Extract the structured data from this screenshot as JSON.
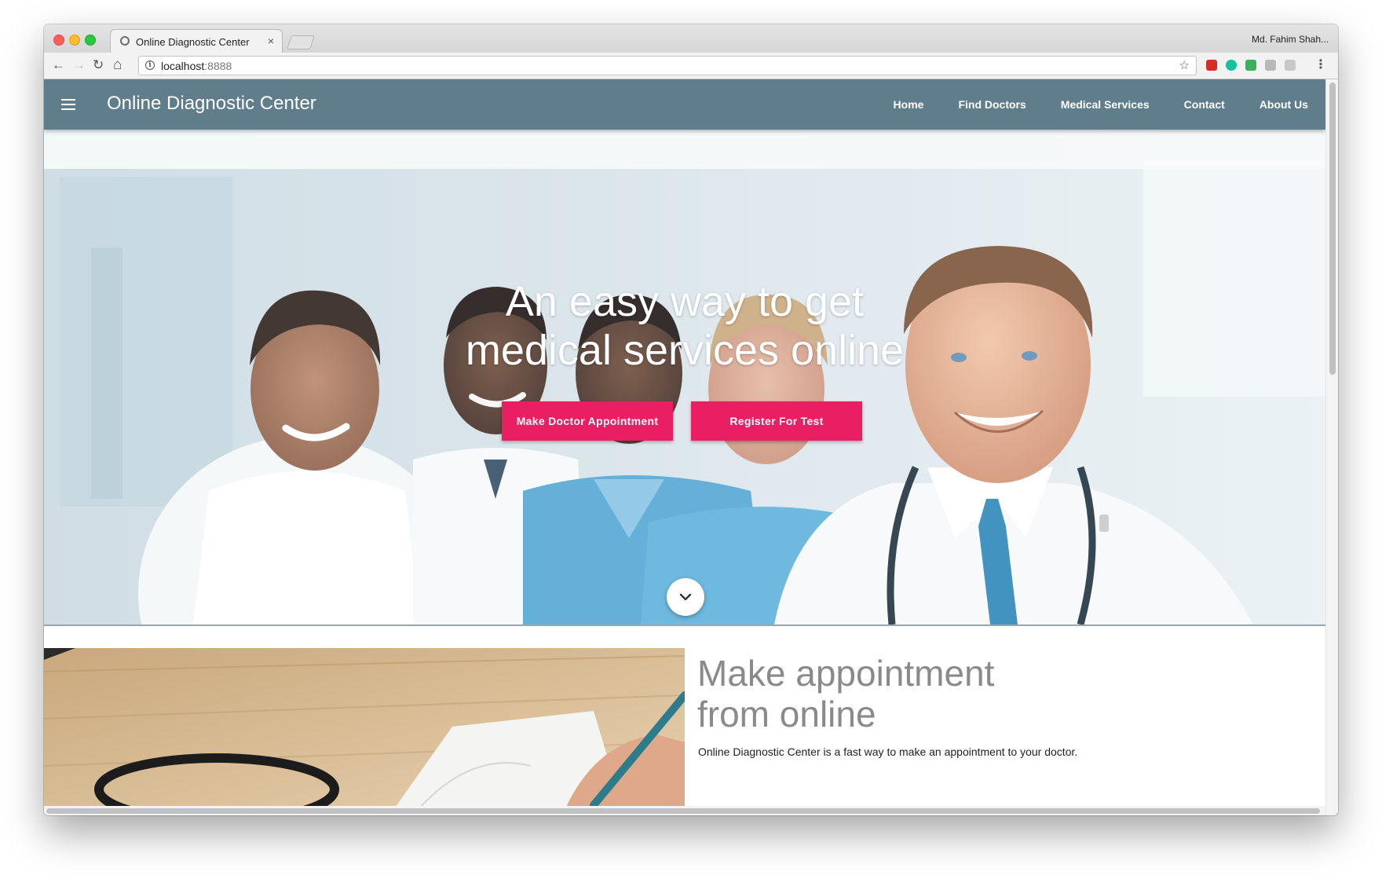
{
  "browser": {
    "tab_title": "Online Diagnostic Center",
    "tab_close": "×",
    "profile_name": "Md. Fahim Shah...",
    "url_host": "localhost",
    "url_port": ":8888",
    "info_glyph": "i",
    "star_glyph": "☆",
    "back_glyph": "←",
    "forward_glyph": "→",
    "reload_glyph": "↻",
    "home_glyph": "⌂",
    "menu_glyph": "⋮",
    "extensions": [
      {
        "name": "lastpass-extension-icon",
        "color": "#d32d27"
      },
      {
        "name": "grammarly-extension-icon",
        "color": "#15c39a"
      },
      {
        "name": "shield-extension-icon",
        "color": "#3fae5a"
      },
      {
        "name": "grey-extension-icon",
        "color": "#b8b8b8"
      },
      {
        "name": "cast-extension-icon",
        "color": "#c8c8c8"
      }
    ]
  },
  "header": {
    "brand": "Online Diagnostic Center",
    "nav": [
      "Home",
      "Find Doctors",
      "Medical Services",
      "Contact",
      "About Us"
    ],
    "bar_color": "#607d8b"
  },
  "hero": {
    "title_line1": "An easy way to get",
    "title_line2": "medical services online",
    "btn_appointment": "Make Doctor Appointment",
    "btn_register": "Register For Test",
    "accent_color": "#e91e63"
  },
  "section": {
    "title_line1": "Make appointment",
    "title_line2": "from online",
    "text": "Online Diagnostic Center is a fast way to make an appointment to your doctor."
  }
}
